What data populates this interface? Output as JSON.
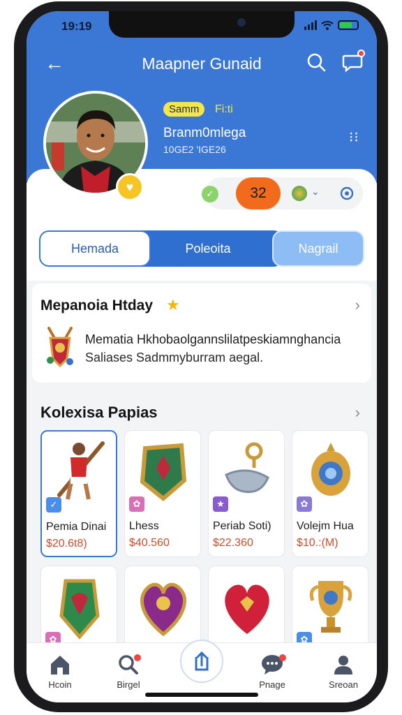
{
  "status_bar": {
    "time": "19:19"
  },
  "header": {
    "title": "Maapner Gunaid"
  },
  "profile": {
    "tag": "Samm",
    "tag_extra": "Fi:ti",
    "name": "Branm0mlega",
    "subtitle": "10GE2 'IGE26"
  },
  "stats": {
    "green_badge": "✓",
    "score": "32"
  },
  "tabs": [
    {
      "label": "Hemada"
    },
    {
      "label": "Poleoita"
    },
    {
      "label": "Nagrail"
    }
  ],
  "featured": {
    "title": "Mepanoia Htday",
    "line1": "Mematia Hkhobaolgannslilatpeskiamnghancia",
    "line2": "Saliases Sadmmyburram aegal."
  },
  "collection": {
    "title": "Kolexisa Papias",
    "items": [
      {
        "name": "Pemia Dinai",
        "price": "$20.6t8)"
      },
      {
        "name": "Lhess",
        "price": "$40.560"
      },
      {
        "name": "Periab Soti)",
        "price": "$22.360"
      },
      {
        "name": "Volejm Hua",
        "price": "$10.:(M)"
      }
    ]
  },
  "nav": [
    {
      "label": "Hcoin",
      "icon": "home-icon"
    },
    {
      "label": "Birgel",
      "icon": "search-icon"
    },
    {
      "label": "",
      "icon": "upload-icon"
    },
    {
      "label": "Pnage",
      "icon": "chat-icon"
    },
    {
      "label": "Sreoan",
      "icon": "profile-icon"
    }
  ],
  "colors": {
    "primary": "#3b78d6",
    "accent": "#f26a1b",
    "badge": "#f4e64a"
  }
}
